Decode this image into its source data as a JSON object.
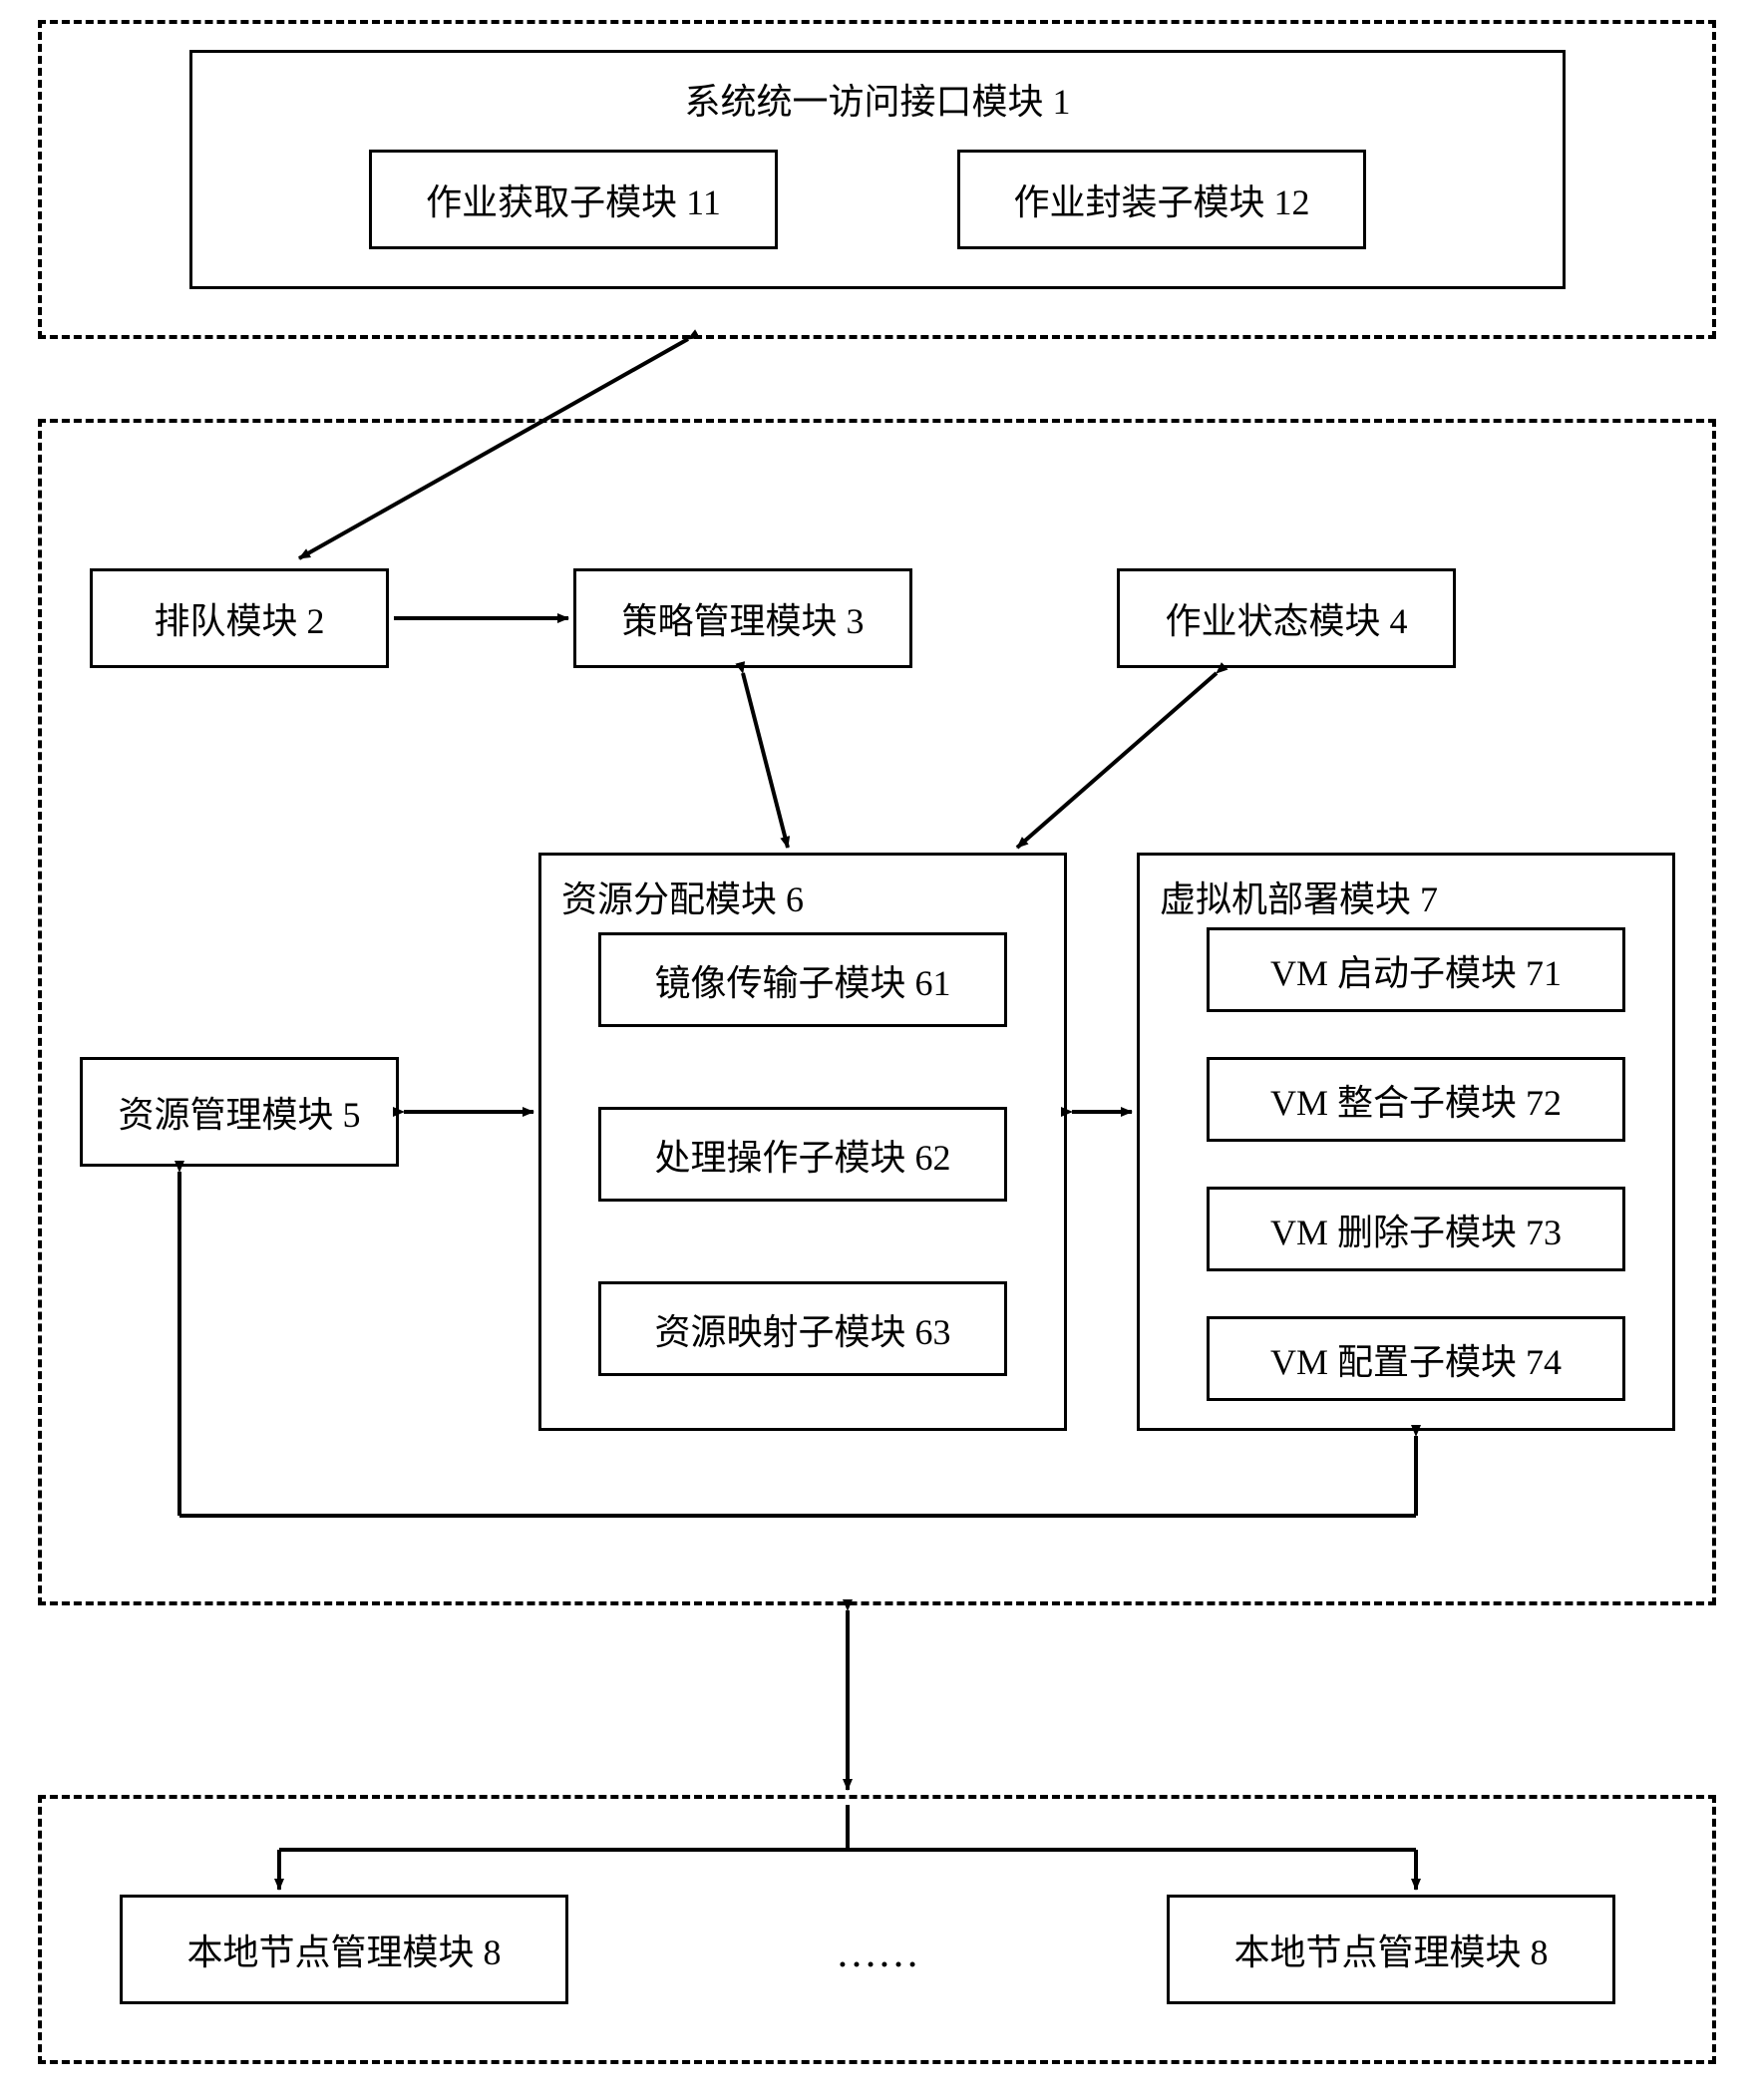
{
  "top_group": {
    "module1": {
      "title": "系统统一访问接口模块 1",
      "sub11": "作业获取子模块 11",
      "sub12": "作业封装子模块 12"
    }
  },
  "middle_group": {
    "module2": "排队模块 2",
    "module3": "策略管理模块 3",
    "module4": "作业状态模块 4",
    "module5": "资源管理模块 5",
    "module6": {
      "title": "资源分配模块 6",
      "sub61": "镜像传输子模块 61",
      "sub62": "处理操作子模块 62",
      "sub63": "资源映射子模块 63"
    },
    "module7": {
      "title": "虚拟机部署模块 7",
      "sub71": "VM 启动子模块 71",
      "sub72": "VM 整合子模块 72",
      "sub73": "VM 删除子模块 73",
      "sub74": "VM 配置子模块 74"
    }
  },
  "bottom_group": {
    "module8a": "本地节点管理模块 8",
    "ellipsis": "……",
    "module8b": "本地节点管理模块 8"
  }
}
